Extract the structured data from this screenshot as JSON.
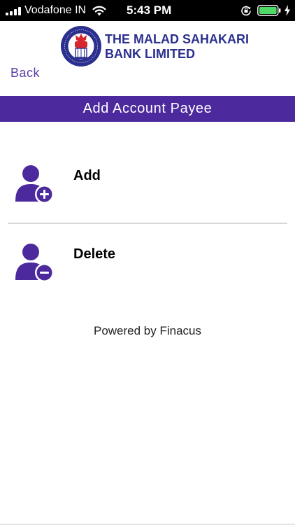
{
  "status_bar": {
    "carrier": "Vodafone IN",
    "time": "5:43 PM",
    "icons": [
      "signal-icon",
      "wifi-icon",
      "orientation-lock-icon",
      "battery-icon",
      "charging-icon"
    ],
    "battery_level": 1.0
  },
  "header": {
    "bank_name_line1": "THE MALAD SAHAKARI",
    "bank_name_line2": "BANK LIMITED",
    "back_label": "Back",
    "logo_icon": "bank-logo-icon"
  },
  "title_bar": {
    "title": "Add Account Payee"
  },
  "options": {
    "add": {
      "label": "Add",
      "icon": "user-add-icon"
    },
    "delete": {
      "label": "Delete",
      "icon": "user-remove-icon"
    }
  },
  "footer": {
    "powered_by": "Powered by Finacus"
  },
  "colors": {
    "primary": "#4c2a9e",
    "back_link": "#5b3fa6",
    "bank_name": "#2b2f8e",
    "logo_red": "#d7262e"
  }
}
